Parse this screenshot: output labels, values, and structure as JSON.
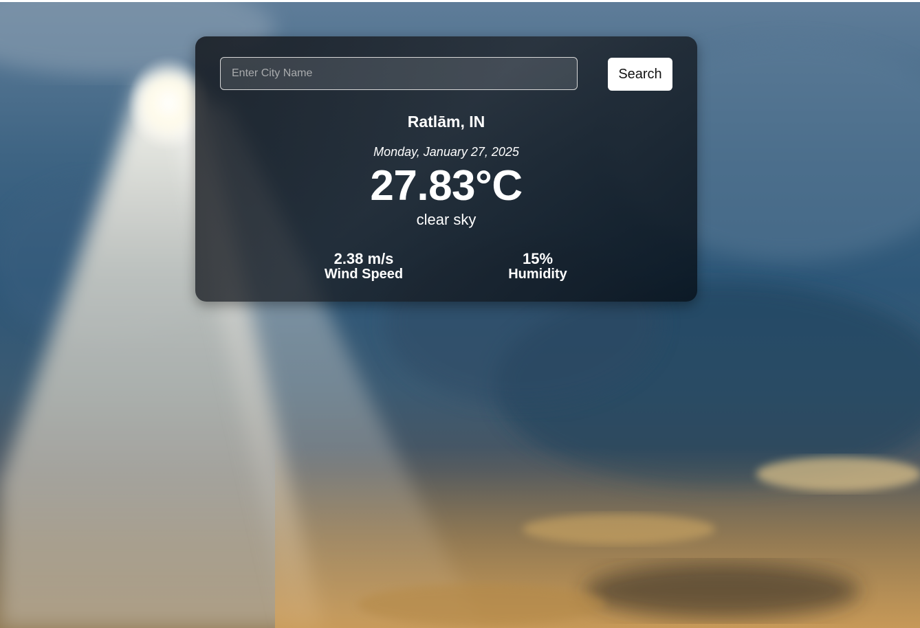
{
  "search": {
    "placeholder": "Enter City Name",
    "value": "",
    "button_label": "Search"
  },
  "weather": {
    "city": "Ratlām, IN",
    "date": "Monday, January 27, 2025",
    "temperature": "27.83°C",
    "description": "clear sky"
  },
  "stats": {
    "wind_value": "2.38 m/s",
    "wind_label": "Wind Speed",
    "humidity_value": "15%",
    "humidity_label": "Humidity"
  },
  "colors": {
    "card_background": "#14181e",
    "text": "#ffffff",
    "button_background": "#ffffff",
    "button_text": "#111111"
  }
}
